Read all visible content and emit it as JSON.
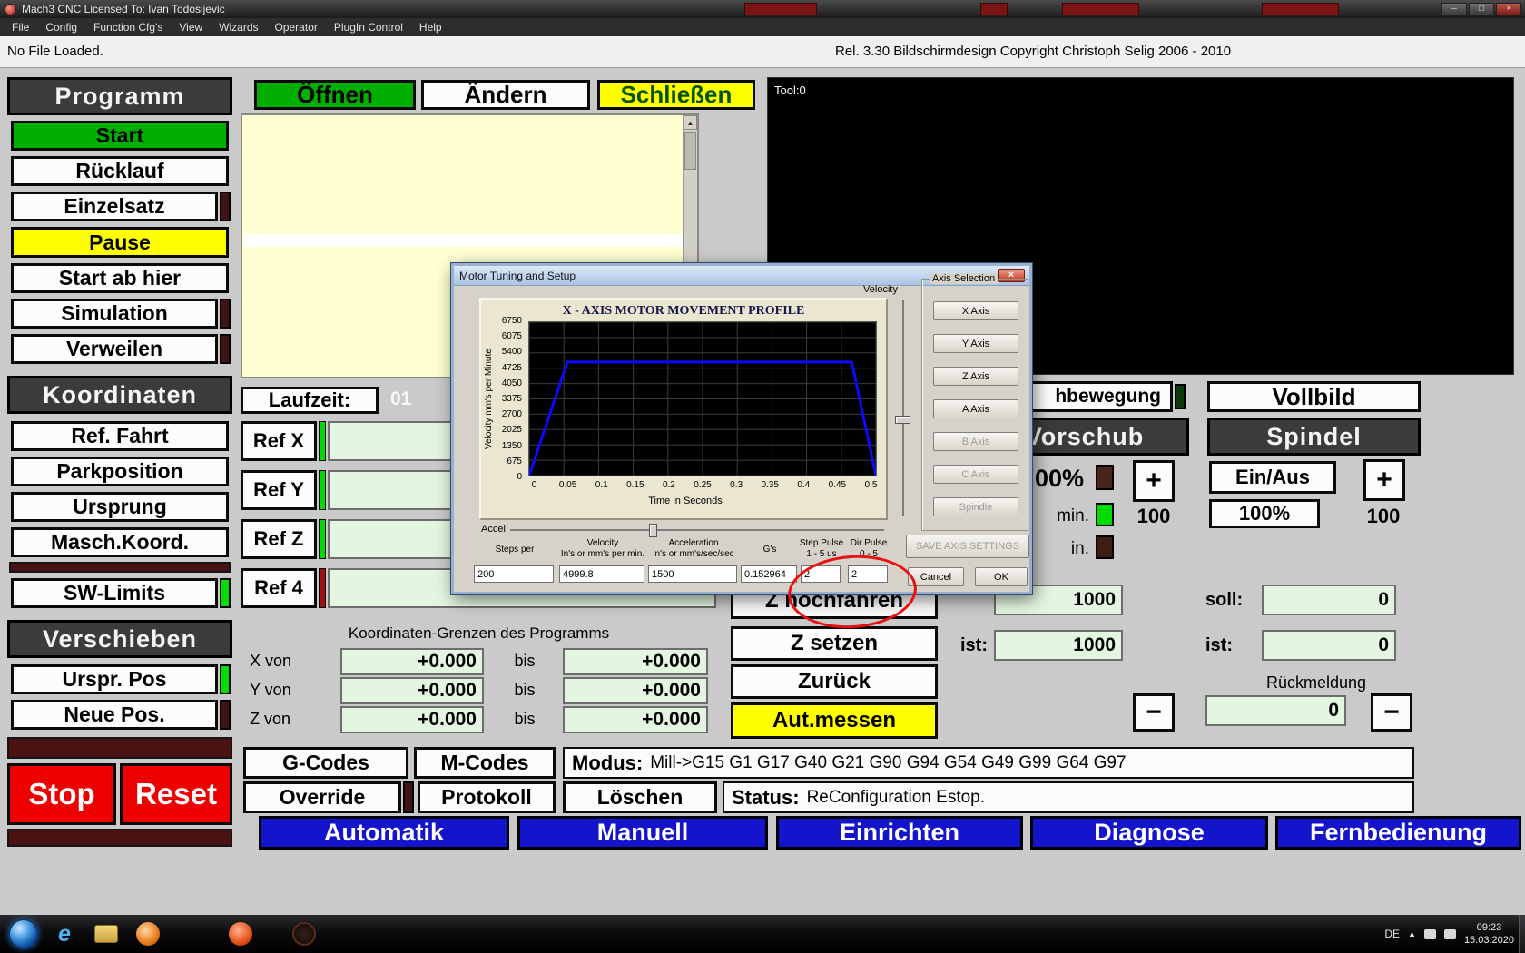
{
  "titlebar": {
    "title": "Mach3 CNC Licensed To: Ivan Todosijevic",
    "minimize": "–",
    "maximize": "□",
    "close": "×"
  },
  "menubar": {
    "items": [
      "File",
      "Config",
      "Function Cfg's",
      "View",
      "Wizards",
      "Operator",
      "PlugIn Control",
      "Help"
    ]
  },
  "infobar": {
    "file_status": "No File Loaded.",
    "release_info": "Rel. 3.30 Bildschirmdesign Copyright Christoph Selig 2006 - 2010"
  },
  "icons": {
    "up": "▲",
    "down": "▼"
  },
  "sidebar": {
    "programm_header": "Programm",
    "start": "Start",
    "ruecklauf": "Rücklauf",
    "einzelsatz": "Einzelsatz",
    "pause": "Pause",
    "start_ab_hier": "Start ab hier",
    "simulation": "Simulation",
    "verweilen": "Verweilen",
    "koordinaten_header": "Koordinaten",
    "ref_fahrt": "Ref. Fahrt",
    "parkposition": "Parkposition",
    "ursprung": "Ursprung",
    "masch_koord": "Masch.Koord.",
    "sw_limits": "SW-Limits",
    "verschieben_header": "Verschieben",
    "urspr_pos": "Urspr. Pos",
    "neue_pos": "Neue Pos.",
    "stop": "Stop",
    "reset": "Reset"
  },
  "program_panel": {
    "oeffnen": "Öffnen",
    "aendern": "Ändern",
    "schliessen": "Schließen",
    "laufzeit_label": "Laufzeit:",
    "laufzeit_value": "01"
  },
  "ref_panel": {
    "ref_x": "Ref X",
    "ref_y": "Ref Y",
    "ref_z": "Ref Z",
    "ref_4": "Ref 4"
  },
  "grenzen": {
    "title": "Koordinaten-Grenzen des Programms",
    "rows": [
      {
        "label": "X von",
        "von": "+0.000",
        "bis_label": "bis",
        "bis": "+0.000"
      },
      {
        "label": "Y von",
        "von": "+0.000",
        "bis_label": "bis",
        "bis": "+0.000"
      },
      {
        "label": "Z von",
        "von": "+0.000",
        "bis_label": "bis",
        "bis": "+0.000"
      }
    ]
  },
  "toolpath": {
    "tool_label": "Tool:0",
    "partial_button": "hbewegung",
    "vollbild": "Vollbild"
  },
  "vorschub": {
    "header": "Vorschub",
    "override_value": "00%",
    "plus": "+",
    "minus": "−",
    "unit_min": "min.",
    "value_100": "100",
    "unit_in": "in.",
    "feed_value": "1000",
    "ist_label": "ist:",
    "ist_value": "1000"
  },
  "spindel": {
    "header": "Spindel",
    "ein_aus": "Ein/Aus",
    "plus": "+",
    "minus": "−",
    "pct": "100%",
    "value_100": "100",
    "soll_label": "soll:",
    "soll_value": "0",
    "ist_label": "ist:",
    "ist_value": "0",
    "rueckmeldung_label": "Rückmeldung",
    "rueckmeldung_value": "0"
  },
  "z_panel": {
    "hochfahren": "Z hochfahren",
    "setzen": "Z setzen",
    "zurueck": "Zurück",
    "aut_messen": "Aut.messen"
  },
  "bottombar": {
    "g_codes": "G-Codes",
    "m_codes": "M-Codes",
    "modus_label": "Modus:",
    "modus_value": "Mill->G15 G1 G17 G40 G21 G90 G94 G54 G49 G99 G64 G97",
    "override": "Override",
    "protokoll": "Protokoll",
    "loeschen": "Löschen",
    "status_label": "Status:",
    "status_value": "ReConfiguration Estop.",
    "tabs": [
      "Automatik",
      "Manuell",
      "Einrichten",
      "Diagnose",
      "Fernbedienung"
    ]
  },
  "taskbar": {
    "lang": "DE",
    "time": "09:23",
    "date": "15.03.2020"
  },
  "dialog": {
    "title": "Motor Tuning and Setup",
    "close": "×",
    "velocity_label": "Velocity",
    "accel_label": "Accel",
    "axis_selection_legend": "Axis Selection",
    "axis_buttons": [
      "X Axis",
      "Y Axis",
      "Z Axis",
      "A Axis",
      "B Axis",
      "C Axis",
      "Spindle"
    ],
    "save_button": "SAVE AXIS SETTINGS",
    "cancel": "Cancel",
    "ok": "OK",
    "fields": [
      {
        "label": "Steps per",
        "sub": "",
        "value": "200"
      },
      {
        "label": "Velocity",
        "sub": "In's or mm's per min.",
        "value": "4999.8"
      },
      {
        "label": "Acceleration",
        "sub": "in's or mm's/sec/sec",
        "value": "1500"
      },
      {
        "label": "G's",
        "sub": "",
        "value": "0.152964"
      },
      {
        "label": "Step Pulse",
        "sub": "1 - 5 us",
        "value": "2"
      },
      {
        "label": "Dir Pulse",
        "sub": "0 - 5",
        "value": "2"
      }
    ],
    "chart_data": {
      "type": "line",
      "title": "X - AXIS MOTOR MOVEMENT PROFILE",
      "xlabel": "Time in Seconds",
      "ylabel": "Velocity mm's per Minute",
      "x_ticks": [
        0,
        0.05,
        0.1,
        0.15,
        0.2,
        0.25,
        0.3,
        0.35,
        0.4,
        0.45,
        0.5
      ],
      "y_ticks": [
        0,
        675,
        1350,
        2025,
        2700,
        3375,
        4050,
        4725,
        5400,
        6075,
        6750
      ],
      "xlim": [
        0,
        0.5
      ],
      "ylim": [
        0,
        6750
      ],
      "grid": true,
      "line_color": "#0a0aff",
      "series": [
        {
          "name": "x-axis-velocity-profile",
          "points": [
            [
              0,
              0
            ],
            [
              0.055,
              4999.8
            ],
            [
              0.465,
              4999.8
            ],
            [
              0.5,
              0
            ]
          ]
        }
      ]
    }
  }
}
